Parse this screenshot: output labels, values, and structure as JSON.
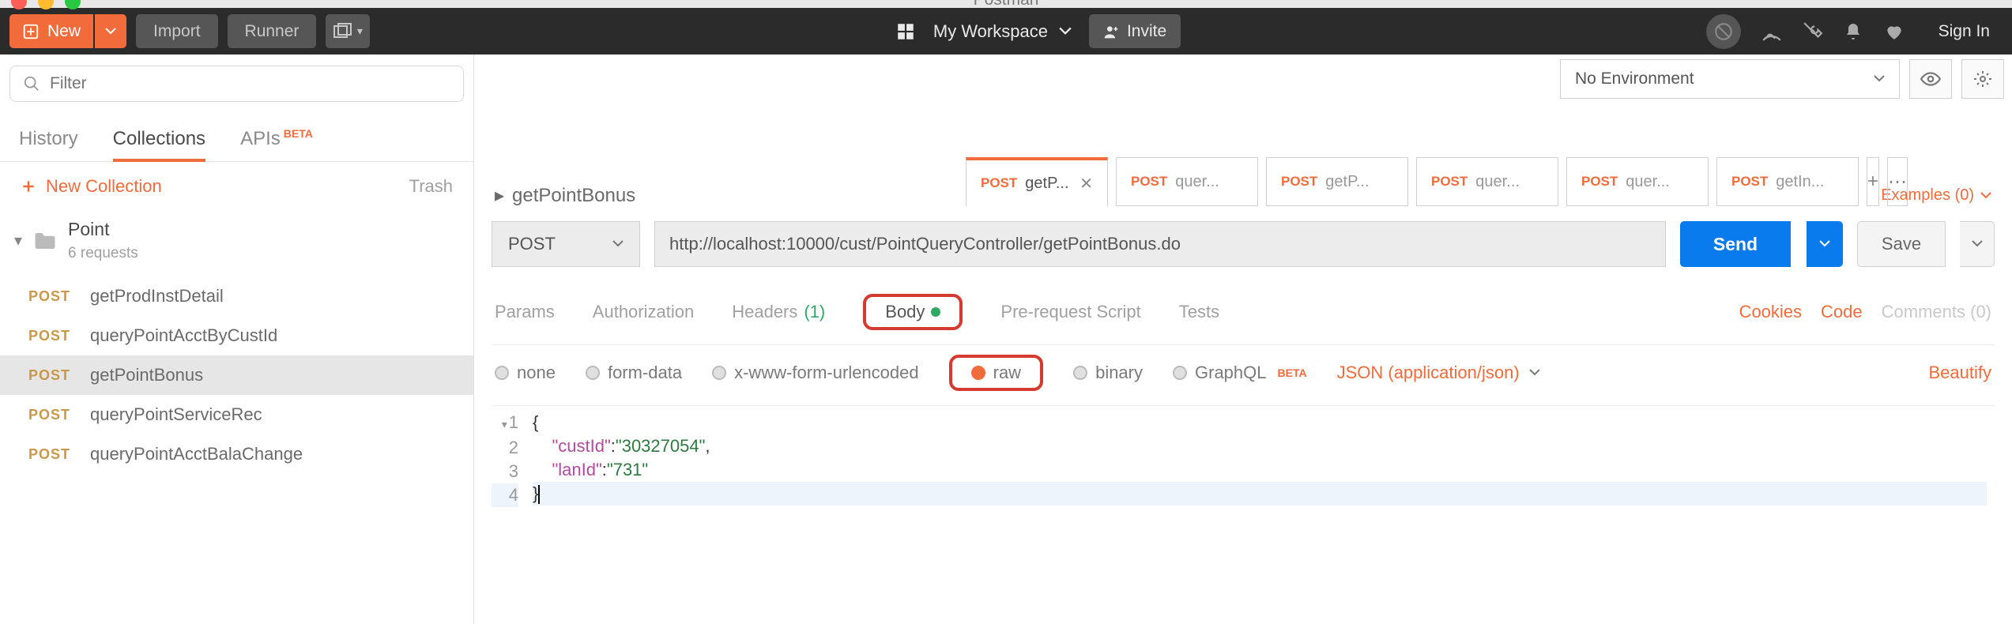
{
  "app_title": "Postman",
  "header": {
    "new": "New",
    "import": "Import",
    "runner": "Runner",
    "workspace": "My Workspace",
    "invite": "Invite",
    "signin": "Sign In"
  },
  "sidebar": {
    "filter_placeholder": "Filter",
    "tabs": {
      "history": "History",
      "collections": "Collections",
      "apis": "APIs",
      "beta": "BETA"
    },
    "new_collection": "New Collection",
    "trash": "Trash",
    "collection": {
      "name": "Point",
      "sub": "6 requests"
    },
    "requests": [
      {
        "method": "POST",
        "name": "getProdInstDetail"
      },
      {
        "method": "POST",
        "name": "queryPointAcctByCustId"
      },
      {
        "method": "POST",
        "name": "getPointBonus"
      },
      {
        "method": "POST",
        "name": "queryPointServiceRec"
      },
      {
        "method": "POST",
        "name": "queryPointAcctBalaChange"
      }
    ]
  },
  "env": {
    "no_env": "No Environment"
  },
  "tabs": [
    {
      "method": "POST",
      "label": "getP..."
    },
    {
      "method": "POST",
      "label": "quer..."
    },
    {
      "method": "POST",
      "label": "getP..."
    },
    {
      "method": "POST",
      "label": "quer..."
    },
    {
      "method": "POST",
      "label": "quer..."
    },
    {
      "method": "POST",
      "label": "getIn..."
    }
  ],
  "request": {
    "name": "getPointBonus",
    "examples": "Examples (0)",
    "method": "POST",
    "url": "http://localhost:10000/cust/PointQueryController/getPointBonus.do",
    "send": "Send",
    "save": "Save"
  },
  "reqtabs": {
    "params": "Params",
    "auth": "Authorization",
    "headers": "Headers",
    "headers_count": "(1)",
    "body": "Body",
    "prereq": "Pre-request Script",
    "tests": "Tests",
    "cookies": "Cookies",
    "code": "Code",
    "comments": "Comments (0)"
  },
  "body_types": {
    "none": "none",
    "form": "form-data",
    "xwww": "x-www-form-urlencoded",
    "raw": "raw",
    "binary": "binary",
    "graphql": "GraphQL",
    "beta": "BETA",
    "json": "JSON (application/json)",
    "beautify": "Beautify"
  },
  "editor": {
    "l1": "{",
    "l2a": "\"custId\"",
    "l2b": ":",
    "l2c": "\"30327054\"",
    "l2d": ",",
    "l3a": "\"lanId\"",
    "l3b": ":",
    "l3c": "\"731\"",
    "l4": "}",
    "n1": "1",
    "n2": "2",
    "n3": "3",
    "n4": "4"
  }
}
